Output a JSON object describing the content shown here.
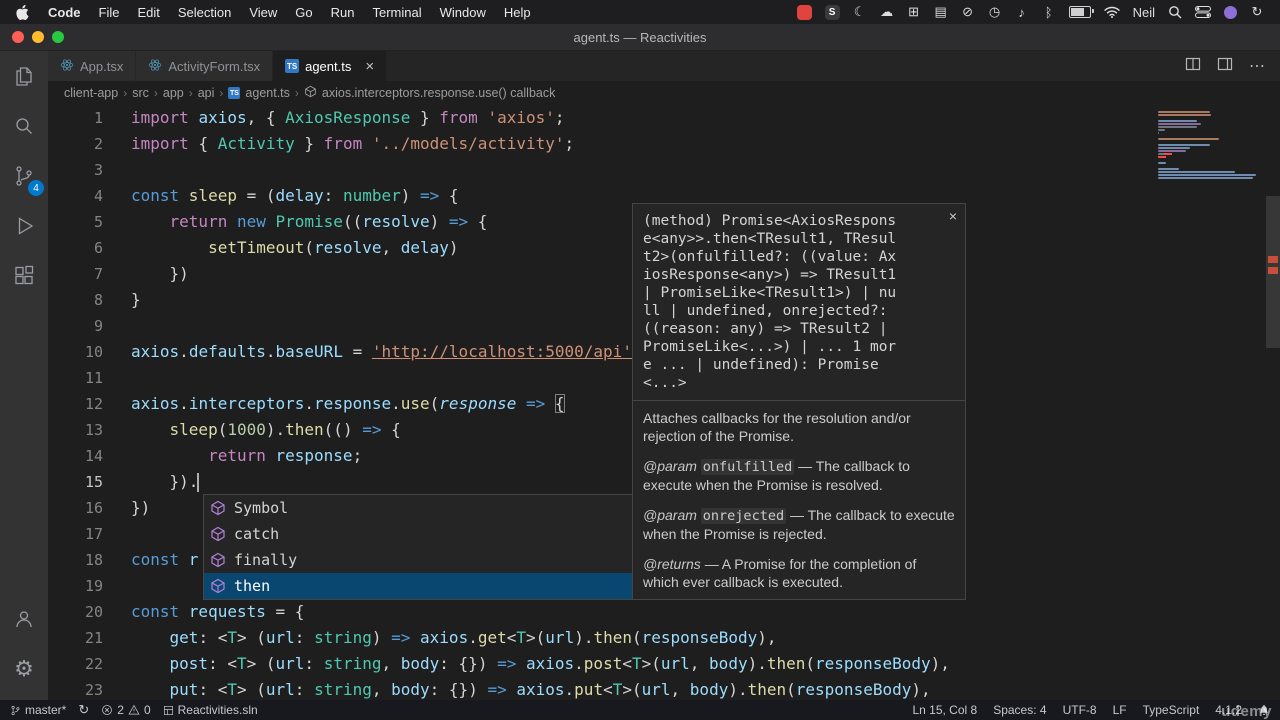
{
  "colors": {
    "accent": "#007acc",
    "error": "#f14c4c",
    "warning": "#cca700",
    "selection": "#094771",
    "badge": "#007acc"
  },
  "menu_bar": {
    "items": [
      "Code",
      "File",
      "Edit",
      "Selection",
      "View",
      "Go",
      "Run",
      "Terminal",
      "Window",
      "Help"
    ],
    "user": "Neil",
    "right_icons": [
      {
        "name": "screen-record-app-icon",
        "type": "appbadge",
        "bg": "#e0443e",
        "glyph": ""
      },
      {
        "name": "s-app-icon",
        "type": "appbadge",
        "bg": "#3a3a3c",
        "glyph": "S"
      },
      {
        "name": "moon-icon",
        "type": "glyph",
        "glyph": "☾"
      },
      {
        "name": "cloud-icon",
        "type": "glyph",
        "glyph": "☁"
      },
      {
        "name": "window-grid-icon",
        "type": "glyph",
        "glyph": "⊞"
      },
      {
        "name": "chat-icon",
        "type": "glyph",
        "glyph": "▤"
      },
      {
        "name": "do-not-disturb-icon",
        "type": "glyph",
        "glyph": "⊘"
      },
      {
        "name": "clock-icon",
        "type": "glyph",
        "glyph": "◷"
      },
      {
        "name": "volume-icon",
        "type": "glyph",
        "glyph": "♪"
      },
      {
        "name": "bluetooth-icon",
        "type": "glyph",
        "glyph": "ᛒ"
      },
      {
        "name": "battery-icon",
        "type": "battery",
        "glyph": ""
      },
      {
        "name": "wifi-icon",
        "type": "svg",
        "glyph": "wifi"
      }
    ],
    "trailing_icons": [
      {
        "name": "spotlight-search-icon",
        "type": "svg",
        "glyph": "search"
      },
      {
        "name": "control-center-icon",
        "type": "svg",
        "glyph": "toggles"
      },
      {
        "name": "app-dot-icon",
        "type": "dot",
        "bg": "#8e6fd8",
        "glyph": ""
      },
      {
        "name": "time-machine-icon",
        "type": "glyph",
        "glyph": "↻"
      }
    ]
  },
  "window": {
    "title": "agent.ts — Reactivities"
  },
  "tabs": {
    "close_glyph": "×",
    "items": [
      {
        "label": "App.tsx",
        "icon": "react",
        "active": false
      },
      {
        "label": "ActivityForm.tsx",
        "icon": "react",
        "active": false
      },
      {
        "label": "agent.ts",
        "icon": "ts",
        "active": true
      }
    ]
  },
  "breadcrumb": {
    "separator": "›",
    "items": [
      "client-app",
      "src",
      "app",
      "api",
      "agent.ts",
      "axios.interceptors.response.use() callback"
    ]
  },
  "activity_bar": {
    "badge": "4",
    "items": [
      "explorer",
      "search",
      "source-control",
      "run-debug",
      "extensions",
      "account",
      "settings"
    ]
  },
  "editor": {
    "cursor": {
      "line": 15,
      "col": 8
    },
    "problem_rows": [
      15,
      16
    ],
    "lines": [
      {
        "n": 1,
        "t": [
          [
            "k",
            "import "
          ],
          [
            "v",
            "axios"
          ],
          [
            "p",
            ", { "
          ],
          [
            "t",
            "AxiosResponse"
          ],
          [
            "p",
            " } "
          ],
          [
            "k",
            "from "
          ],
          [
            "s",
            "'axios'"
          ],
          [
            "p",
            ";"
          ]
        ]
      },
      {
        "n": 2,
        "t": [
          [
            "k",
            "import "
          ],
          [
            "p",
            "{ "
          ],
          [
            "t",
            "Activity"
          ],
          [
            "p",
            " } "
          ],
          [
            "k",
            "from "
          ],
          [
            "s",
            "'../models/activity'"
          ],
          [
            "p",
            ";"
          ]
        ]
      },
      {
        "n": 3,
        "t": []
      },
      {
        "n": 4,
        "t": [
          [
            "b",
            "const "
          ],
          [
            "f",
            "sleep"
          ],
          [
            "p",
            " = ("
          ],
          [
            "v",
            "delay"
          ],
          [
            "p",
            ": "
          ],
          [
            "t",
            "number"
          ],
          [
            "p",
            ") "
          ],
          [
            "b",
            "=>"
          ],
          [
            "p",
            " {"
          ]
        ]
      },
      {
        "n": 5,
        "t": [
          [
            "p",
            "    "
          ],
          [
            "k",
            "return "
          ],
          [
            "b",
            "new "
          ],
          [
            "t",
            "Promise"
          ],
          [
            "p",
            "(("
          ],
          [
            "v",
            "resolve"
          ],
          [
            "p",
            ") "
          ],
          [
            "b",
            "=>"
          ],
          [
            "p",
            " {"
          ]
        ]
      },
      {
        "n": 6,
        "t": [
          [
            "p",
            "        "
          ],
          [
            "f",
            "setTimeout"
          ],
          [
            "p",
            "("
          ],
          [
            "v",
            "resolve"
          ],
          [
            "p",
            ", "
          ],
          [
            "v",
            "delay"
          ],
          [
            "p",
            ")"
          ]
        ]
      },
      {
        "n": 7,
        "t": [
          [
            "p",
            "    })"
          ]
        ]
      },
      {
        "n": 8,
        "t": [
          [
            "p",
            "}"
          ]
        ]
      },
      {
        "n": 9,
        "t": []
      },
      {
        "n": 10,
        "t": [
          [
            "v",
            "axios"
          ],
          [
            "p",
            "."
          ],
          [
            "v",
            "defaults"
          ],
          [
            "p",
            "."
          ],
          [
            "v",
            "baseURL"
          ],
          [
            "p",
            " = "
          ],
          [
            "u",
            "'http://localhost:5000/api'"
          ],
          [
            "p",
            ";"
          ]
        ]
      },
      {
        "n": 11,
        "t": []
      },
      {
        "n": 12,
        "t": [
          [
            "v",
            "axios"
          ],
          [
            "p",
            "."
          ],
          [
            "v",
            "interceptors"
          ],
          [
            "p",
            "."
          ],
          [
            "v",
            "response"
          ],
          [
            "p",
            "."
          ],
          [
            "f",
            "use"
          ],
          [
            "p",
            "("
          ],
          [
            "i",
            "response"
          ],
          [
            "p",
            " "
          ],
          [
            "b",
            "=>"
          ],
          [
            "p",
            " "
          ],
          [
            "m",
            "{"
          ]
        ]
      },
      {
        "n": 13,
        "t": [
          [
            "p",
            "    "
          ],
          [
            "f",
            "sleep"
          ],
          [
            "p",
            "("
          ],
          [
            "n2",
            "1000"
          ],
          [
            "p",
            ")."
          ],
          [
            "f",
            "then"
          ],
          [
            "p",
            "(() "
          ],
          [
            "b",
            "=>"
          ],
          [
            "p",
            " {"
          ]
        ]
      },
      {
        "n": 14,
        "t": [
          [
            "p",
            "        "
          ],
          [
            "k",
            "return "
          ],
          [
            "v",
            "response"
          ],
          [
            "p",
            ";"
          ]
        ]
      },
      {
        "n": 15,
        "t": [
          [
            "p",
            "    })."
          ]
        ]
      },
      {
        "n": 16,
        "t": [
          [
            "p",
            "})"
          ]
        ]
      },
      {
        "n": 17,
        "t": []
      },
      {
        "n": 18,
        "t": [
          [
            "b",
            "const "
          ],
          [
            "v",
            "r"
          ]
        ]
      },
      {
        "n": 19,
        "t": []
      },
      {
        "n": 20,
        "t": [
          [
            "b",
            "const "
          ],
          [
            "v",
            "requests"
          ],
          [
            "p",
            " = {"
          ]
        ]
      },
      {
        "n": 21,
        "t": [
          [
            "p",
            "    "
          ],
          [
            "v",
            "get"
          ],
          [
            "p",
            ": <"
          ],
          [
            "t",
            "T"
          ],
          [
            "p",
            "> ("
          ],
          [
            "v",
            "url"
          ],
          [
            "p",
            ": "
          ],
          [
            "t",
            "string"
          ],
          [
            "p",
            ") "
          ],
          [
            "b",
            "=>"
          ],
          [
            "p",
            " "
          ],
          [
            "v",
            "axios"
          ],
          [
            "p",
            "."
          ],
          [
            "f",
            "get"
          ],
          [
            "p",
            "<"
          ],
          [
            "t",
            "T"
          ],
          [
            "p",
            ">("
          ],
          [
            "v",
            "url"
          ],
          [
            "p",
            ")."
          ],
          [
            "f",
            "then"
          ],
          [
            "p",
            "("
          ],
          [
            "v",
            "responseBody"
          ],
          [
            "p",
            "),"
          ]
        ]
      },
      {
        "n": 22,
        "t": [
          [
            "p",
            "    "
          ],
          [
            "v",
            "post"
          ],
          [
            "p",
            ": <"
          ],
          [
            "t",
            "T"
          ],
          [
            "p",
            "> ("
          ],
          [
            "v",
            "url"
          ],
          [
            "p",
            ": "
          ],
          [
            "t",
            "string"
          ],
          [
            "p",
            ", "
          ],
          [
            "v",
            "body"
          ],
          [
            "p",
            ": {}) "
          ],
          [
            "b",
            "=>"
          ],
          [
            "p",
            " "
          ],
          [
            "v",
            "axios"
          ],
          [
            "p",
            "."
          ],
          [
            "f",
            "post"
          ],
          [
            "p",
            "<"
          ],
          [
            "t",
            "T"
          ],
          [
            "p",
            ">("
          ],
          [
            "v",
            "url"
          ],
          [
            "p",
            ", "
          ],
          [
            "v",
            "body"
          ],
          [
            "p",
            ")."
          ],
          [
            "f",
            "then"
          ],
          [
            "p",
            "("
          ],
          [
            "v",
            "responseBody"
          ],
          [
            "p",
            "),"
          ]
        ]
      },
      {
        "n": 23,
        "t": [
          [
            "p",
            "    "
          ],
          [
            "v",
            "put"
          ],
          [
            "p",
            ": <"
          ],
          [
            "t",
            "T"
          ],
          [
            "p",
            "> ("
          ],
          [
            "v",
            "url"
          ],
          [
            "p",
            ": "
          ],
          [
            "t",
            "string"
          ],
          [
            "p",
            ", "
          ],
          [
            "v",
            "body"
          ],
          [
            "p",
            ": {}) "
          ],
          [
            "b",
            "=>"
          ],
          [
            "p",
            " "
          ],
          [
            "v",
            "axios"
          ],
          [
            "p",
            "."
          ],
          [
            "f",
            "put"
          ],
          [
            "p",
            "<"
          ],
          [
            "t",
            "T"
          ],
          [
            "p",
            ">("
          ],
          [
            "v",
            "url"
          ],
          [
            "p",
            ", "
          ],
          [
            "v",
            "body"
          ],
          [
            "p",
            ")."
          ],
          [
            "f",
            "then"
          ],
          [
            "p",
            "("
          ],
          [
            "v",
            "responseBody"
          ],
          [
            "p",
            "),"
          ]
        ]
      }
    ]
  },
  "hover": {
    "close": "×",
    "signature_lines": [
      "(method) Promise<AxiosRespons",
      "e<any>>.then<TResult1, TResul",
      "t2>(onfulfilled?: ((value: Ax",
      "iosResponse<any>) => TResult1",
      "| PromiseLike<TResult1>) | nu",
      "ll | undefined, onrejected?:",
      "((reason: any) => TResult2 |",
      "PromiseLike<...>) | ... 1 mor",
      "e ... | undefined): Promise",
      "<...>"
    ],
    "description": "Attaches callbacks for the resolution and/or rejection of the Promise.",
    "params": [
      {
        "tag": "@param",
        "name": "onfulfilled",
        "text": " — The callback to execute when the Promise is resolved."
      },
      {
        "tag": "@param",
        "name": "onrejected",
        "text": " — The callback to execute when the Promise is rejected."
      }
    ],
    "returns": {
      "tag": "@returns",
      "text": " — A Promise for the completion of which ever callback is executed."
    }
  },
  "suggest": {
    "items": [
      {
        "label": "Symbol",
        "kind": "property",
        "selected": false
      },
      {
        "label": "catch",
        "kind": "method",
        "selected": false
      },
      {
        "label": "finally",
        "kind": "method",
        "selected": false
      },
      {
        "label": "then",
        "kind": "method",
        "selected": true
      }
    ]
  },
  "status_bar": {
    "branch": "master*",
    "errors": "2",
    "warnings": "0",
    "solution": "Reactivities.sln",
    "line_col": "Ln 15, Col 8",
    "spaces": "Spaces: 4",
    "encoding": "UTF-8",
    "eol": "LF",
    "language": "TypeScript",
    "ts_version": "4.1.2"
  },
  "watermark": {
    "text": "udemy"
  }
}
